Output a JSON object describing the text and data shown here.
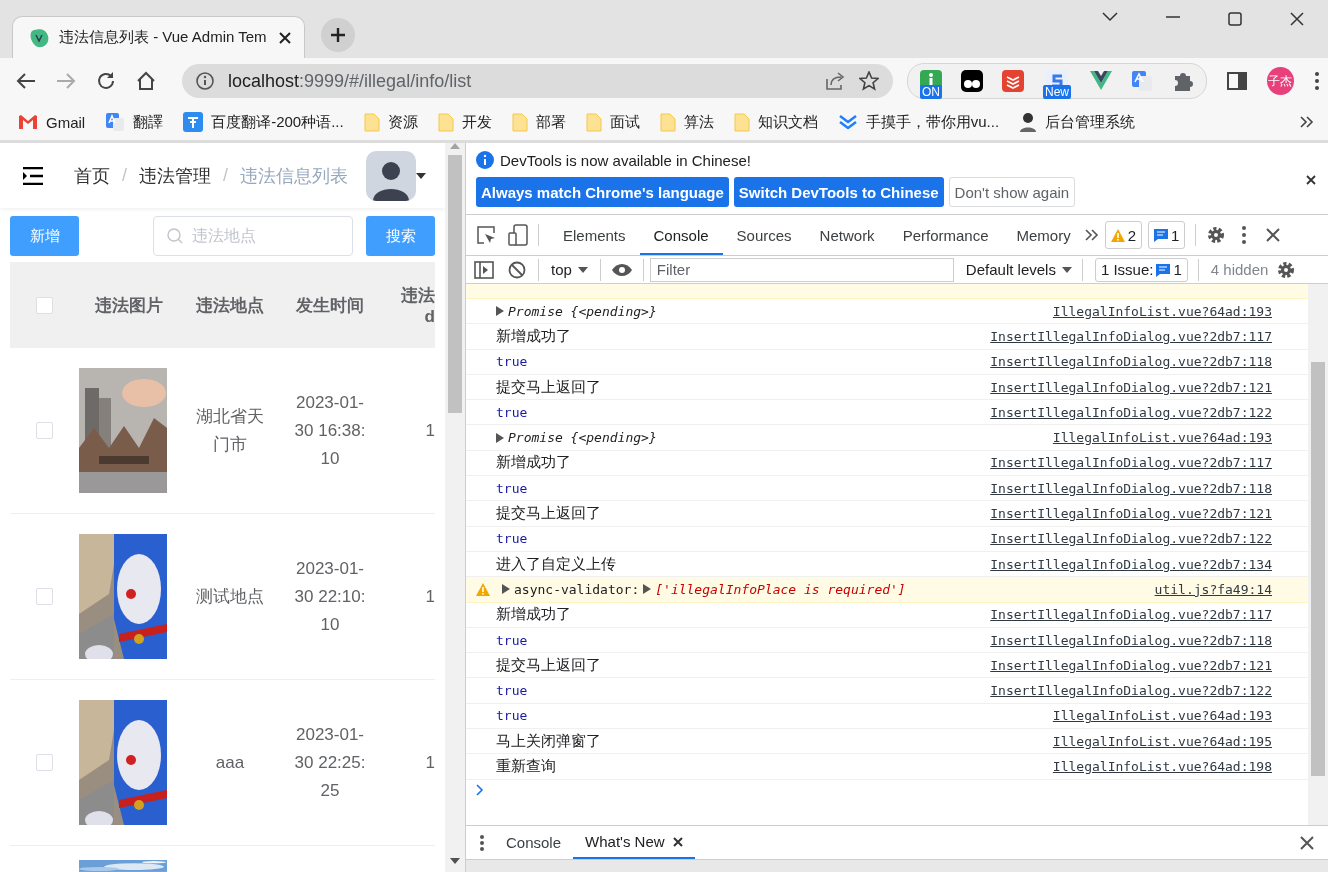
{
  "browser": {
    "tab": {
      "title": "违法信息列表 - Vue Admin Tem"
    },
    "address": {
      "host": "localhost",
      "path": ":9999/#/illegal/info/list"
    },
    "extensions": [
      {
        "kind": "info",
        "badge": "ON"
      },
      {
        "kind": "mask"
      },
      {
        "kind": "todo"
      },
      {
        "kind": "s",
        "badge": "New"
      },
      {
        "kind": "vue"
      },
      {
        "kind": "translate"
      },
      {
        "kind": "puzzle"
      }
    ],
    "profile": "子杰",
    "bookmarks": [
      {
        "kind": "gmail",
        "label": "Gmail"
      },
      {
        "kind": "translate",
        "label": "翻譯"
      },
      {
        "kind": "baidu",
        "label": "百度翻译-200种语..."
      },
      {
        "kind": "folder",
        "label": "资源"
      },
      {
        "kind": "folder",
        "label": "开发"
      },
      {
        "kind": "folder",
        "label": "部署"
      },
      {
        "kind": "folder",
        "label": "面试"
      },
      {
        "kind": "folder",
        "label": "算法"
      },
      {
        "kind": "folder",
        "label": "知识文档"
      },
      {
        "kind": "chevron",
        "label": "手摸手，带你用vu..."
      },
      {
        "kind": "person",
        "label": "后台管理系统"
      }
    ]
  },
  "page": {
    "breadcrumb": [
      {
        "label": "首页",
        "current": false
      },
      {
        "separator": "/",
        "label": "违法管理",
        "current": false
      },
      {
        "separator": "/",
        "label": "违法信息列表",
        "current": true
      }
    ],
    "add_button": "新增",
    "search": {
      "placeholder": "违法地点"
    },
    "search_button": "搜索",
    "table": {
      "header_checked": false,
      "columns": [
        "违法图片",
        "违法地点",
        "发生时间"
      ],
      "column_4": [
        "违法",
        "d"
      ],
      "rows": [
        {
          "checked": false,
          "image": {
            "kind": "picture"
          },
          "location": "湖北省天门市",
          "time": "2023-01-30 16:38:10",
          "column_4": "1"
        },
        {
          "checked": false,
          "image": {
            "kind": "picture"
          },
          "location": "测试地点",
          "time": "2023-01-30 22:10:10",
          "column_4": "1"
        },
        {
          "checked": false,
          "image": {
            "kind": "picture"
          },
          "location": "aaa",
          "time": "2023-01-30 22:25:25",
          "column_4": "1"
        },
        {
          "image": {
            "kind": "picture"
          }
        }
      ]
    }
  },
  "devtools": {
    "infobar": {
      "message": "DevTools is now available in Chinese!",
      "buttons": [
        {
          "label": "Always match Chrome's language",
          "kind": "primary"
        },
        {
          "label": "Switch DevTools to Chinese",
          "kind": "primary"
        },
        {
          "label": "Don't show again",
          "kind": "secondary"
        }
      ]
    },
    "tabs": [
      {
        "label": "Elements",
        "selected": false
      },
      {
        "label": "Console",
        "selected": true
      },
      {
        "label": "Sources",
        "selected": false
      },
      {
        "label": "Network",
        "selected": false
      },
      {
        "label": "Performance",
        "selected": false
      },
      {
        "label": "Memory",
        "selected": false
      }
    ],
    "warning_count": "2",
    "message_count": "1",
    "console_toolbar": {
      "context": "top",
      "filter": {
        "placeholder": "Filter"
      },
      "levels": "Default levels",
      "issues": {
        "label": "1 Issue:",
        "count": "1"
      },
      "hidden": "4 hidden"
    },
    "messages": [
      {
        "kind": "object",
        "text": "Promise {<pending>}",
        "source": "IllegalInfoList.vue?64ad:193"
      },
      {
        "kind": "text",
        "text": "新增成功了",
        "source": "InsertIllegalInfoDialog.vue?2db7:117"
      },
      {
        "kind": "boolean",
        "text": "true",
        "source": "InsertIllegalInfoDialog.vue?2db7:118"
      },
      {
        "kind": "text",
        "text": "提交马上返回了",
        "source": "InsertIllegalInfoDialog.vue?2db7:121"
      },
      {
        "kind": "boolean",
        "text": "true",
        "source": "InsertIllegalInfoDialog.vue?2db7:122"
      },
      {
        "kind": "object",
        "text": "Promise {<pending>}",
        "source": "IllegalInfoList.vue?64ad:193"
      },
      {
        "kind": "text",
        "text": "新增成功了",
        "source": "InsertIllegalInfoDialog.vue?2db7:117"
      },
      {
        "kind": "boolean",
        "text": "true",
        "source": "InsertIllegalInfoDialog.vue?2db7:118"
      },
      {
        "kind": "text",
        "text": "提交马上返回了",
        "source": "InsertIllegalInfoDialog.vue?2db7:121"
      },
      {
        "kind": "boolean",
        "text": "true",
        "source": "InsertIllegalInfoDialog.vue?2db7:122"
      },
      {
        "kind": "text",
        "text": "进入了自定义上传",
        "source": "InsertIllegalInfoDialog.vue?2db7:134"
      },
      {
        "kind": "warning",
        "text": "async-validator:",
        "detail": "['illegalInfoPlace is required']",
        "source": "util.js?fa49:14"
      },
      {
        "kind": "text",
        "text": "新增成功了",
        "source": "InsertIllegalInfoDialog.vue?2db7:117"
      },
      {
        "kind": "boolean",
        "text": "true",
        "source": "InsertIllegalInfoDialog.vue?2db7:118"
      },
      {
        "kind": "text",
        "text": "提交马上返回了",
        "source": "InsertIllegalInfoDialog.vue?2db7:121"
      },
      {
        "kind": "boolean",
        "text": "true",
        "source": "InsertIllegalInfoDialog.vue?2db7:122"
      },
      {
        "kind": "boolean",
        "text": "true",
        "source": "IllegalInfoList.vue?64ad:193"
      },
      {
        "kind": "text",
        "text": "马上关闭弹窗了",
        "source": "IllegalInfoList.vue?64ad:195"
      },
      {
        "kind": "text",
        "text": "重新查询",
        "source": "IllegalInfoList.vue?64ad:198"
      }
    ],
    "drawer_tabs": [
      {
        "label": "Console",
        "selected": false
      },
      {
        "label": "What's New",
        "selected": true
      }
    ]
  }
}
